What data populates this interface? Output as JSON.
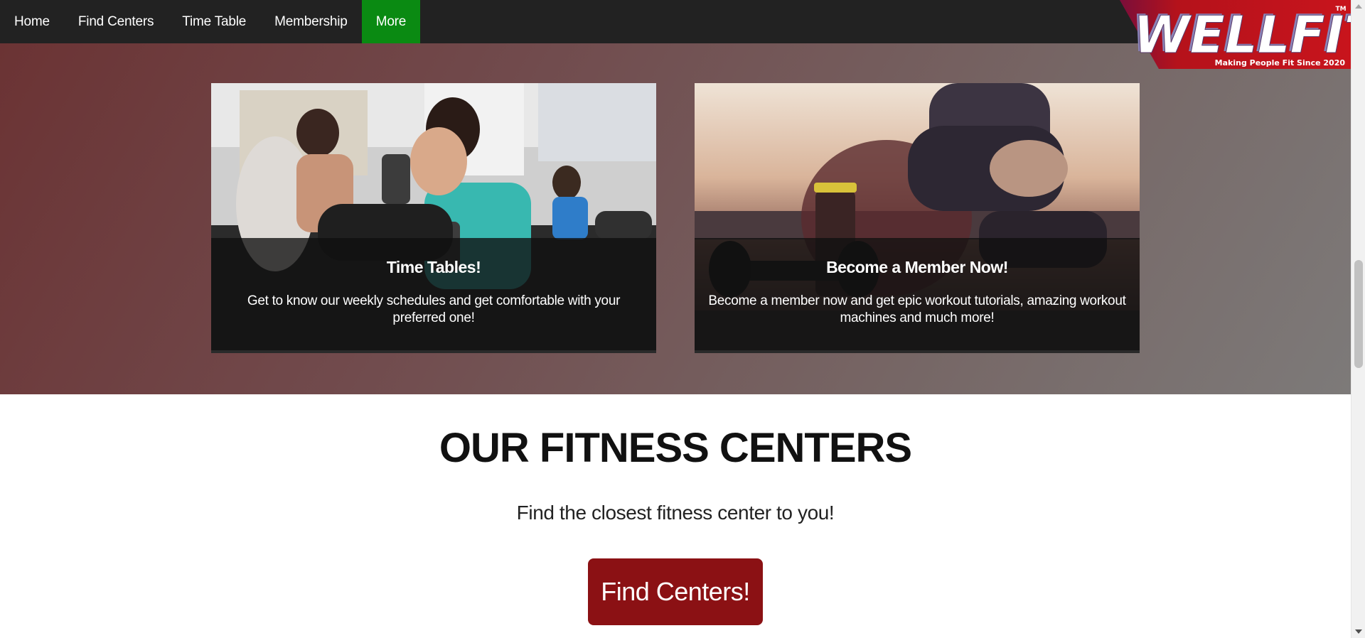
{
  "navbar": {
    "items": [
      {
        "label": "Home"
      },
      {
        "label": "Find Centers"
      },
      {
        "label": "Time Table"
      },
      {
        "label": "Membership"
      },
      {
        "label": "More",
        "active": true
      }
    ]
  },
  "logo": {
    "brand": "WELLFIT",
    "trademark": "TM",
    "tagline": "Making People Fit Since 2020",
    "colors": {
      "background": "#b5121b",
      "text": "#ffffff"
    }
  },
  "cards": [
    {
      "title": "Time Tables!",
      "text": "Get to know our weekly schedules and get comfortable with your preferred one!",
      "image": "group-workout-photo"
    },
    {
      "title": "Become a Member Now!",
      "text": "Become a member now and get epic workout tutorials, amazing workout machines and much more!",
      "image": "gym-dumbbells-photo"
    }
  ],
  "centers": {
    "title": "OUR FITNESS CENTERS",
    "subtitle": "Find the closest fitness center to you!",
    "button_label": "Find Centers!"
  },
  "colors": {
    "navbar": "#222222",
    "active_nav": "#0a8a12",
    "cta": "#8b1114"
  }
}
